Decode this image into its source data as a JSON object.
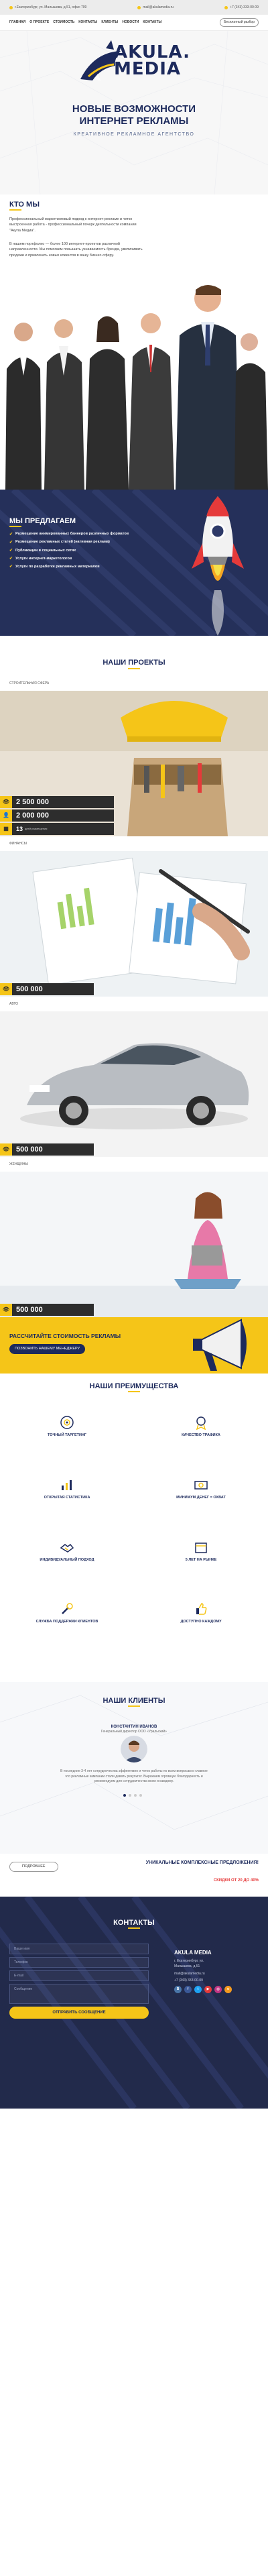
{
  "topbar": {
    "address": "г.Екатеринбург, ул. Малышева, д.51, офис 709",
    "email": "mail@akulamedia.ru",
    "phone": "+7 (343) 333-00-09"
  },
  "nav": {
    "items": [
      "Главная",
      "О проекте",
      "Стоимость",
      "Контакты",
      "Клиенты",
      "Новости",
      "Контакты"
    ],
    "cta": "Бесплатный разбор"
  },
  "hero": {
    "logo_line1": "AKULA.",
    "logo_line2": "MEDIA",
    "title_line1": "НОВЫЕ ВОЗМОЖНОСТИ",
    "title_line2": "ИНТЕРНЕТ РЕКЛАМЫ",
    "subtitle": "Креативное рекламное агентство"
  },
  "about": {
    "title": "КТО МЫ",
    "p1": "Профессиональный маркетинговый подход к интернет-рекламе и четко выстроенная работа - профессиональный почерк деятельности компании \"Акула Медиа\".",
    "p2": "В нашем портфолио — более 100 интернет-проектов различной направленности. Мы помогаем повышать узнаваемость бренда, увеличивать продажи и привлекать новых клиентов в вашу бизнес-сферу."
  },
  "offer": {
    "title": "МЫ ПРЕДЛАГАЕМ",
    "items": [
      "Размещение анимированных баннеров различных форматов",
      "Размещение рекламных статей (нативная реклама)",
      "Публикации в социальных сетях",
      "Услуги интернет-маркетологов",
      "Услуги по разработке рекламных материалов"
    ]
  },
  "projects": {
    "title": "НАШИ ПРОЕКТЫ",
    "p1": {
      "label": "Строительная сфера",
      "views": "2 500 000",
      "users": "2 000 000",
      "days": "13",
      "days_label": "дней размещения"
    },
    "p2": {
      "label": "Финансы",
      "views": "500 000"
    },
    "p3": {
      "label": "Авто",
      "views": "500 000"
    },
    "p4": {
      "label": "Женщины",
      "views": "500 000"
    }
  },
  "cta": {
    "title": "РАССЧИТАЙТЕ СТОИМОСТЬ РЕКЛАМЫ",
    "button": "Позвонить нашему Менеджеру"
  },
  "advantages": {
    "title": "НАШИ ПРЕИМУЩЕСТВА",
    "items": [
      "Точный таргетинг",
      "Качество трафика",
      "Открытая статистика",
      "Минимум денег = охват",
      "Индивидуальный подход",
      "5 лет на рынке",
      "Служба поддержки клиентов",
      "Доступно каждому"
    ]
  },
  "clients": {
    "title": "НАШИ КЛИЕНТЫ",
    "name": "Константин Иванов",
    "role": "Генеральный директор ООО «Уральский»",
    "quote": "В последние 3-4 лет сотрудничества эффективно и четко работы по всем вопросам и главное что рекламные кампании стали давать результат. Выражаем огромную благодарность и рекомендуем для сотрудничества всем и каждому.",
    "promo_button": "Подробнее",
    "promo_title": "Уникальные комплексные предложения!",
    "promo_sub": "Скидки от 20 до 40%"
  },
  "contacts": {
    "title": "КОНТАКТЫ",
    "name_ph": "Ваше имя",
    "phone_ph": "Телефон",
    "email_ph": "E-mail",
    "msg_ph": "Сообщение",
    "submit": "Отправить сообщение",
    "company": "AKULA MEDIA",
    "addr1": "г. Екатеринбург, ул.",
    "addr2": "Малышева, д.51",
    "email": "mail@akulamedia.ru",
    "phone": "+7 (343) 333-00-09",
    "socials": [
      "vk",
      "fb",
      "tw",
      "yt",
      "ig",
      "ok"
    ]
  },
  "colors": {
    "navy": "#1d2a5c",
    "yellow": "#f5c518",
    "red": "#e53a3a",
    "dark": "#2d2d2d"
  }
}
